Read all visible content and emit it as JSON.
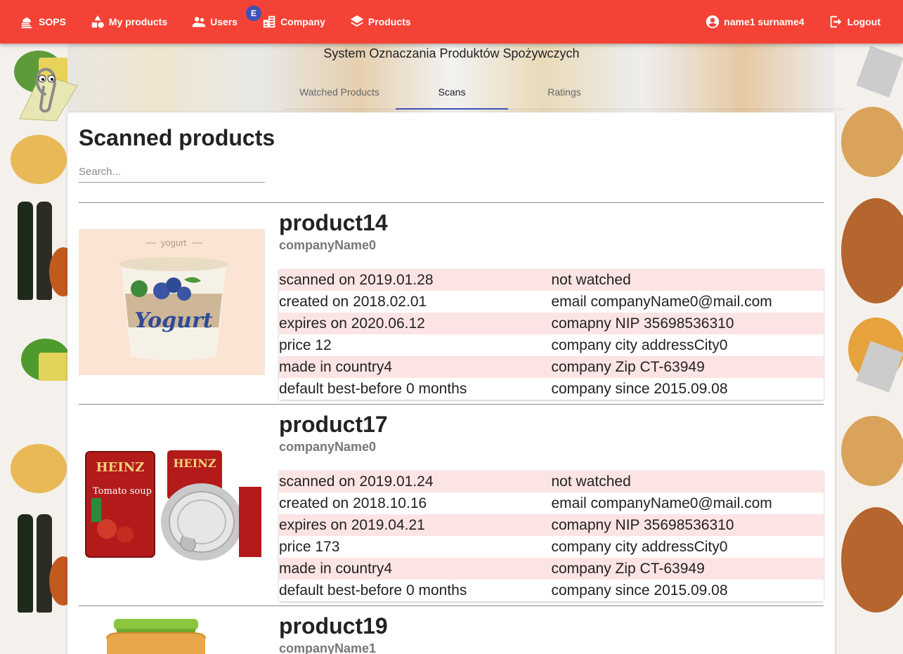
{
  "nav": {
    "brand": "SOPS",
    "my_products": "My products",
    "users": "Users",
    "company": "Company",
    "company_badge": "E",
    "products": "Products",
    "user_name": "name1 surname4",
    "logout": "Logout"
  },
  "app_title": "System Oznaczania Produktów Spożywczych",
  "tabs": [
    "Watched Products",
    "Scans",
    "Ratings"
  ],
  "active_tab": "Scans",
  "page": {
    "heading": "Scanned products",
    "search_placeholder": "Search..."
  },
  "products": [
    {
      "name": "product14",
      "company": "companyName0",
      "image": "yogurt-cup",
      "image_label": "yogurt",
      "image_brand": "Yogurt",
      "left": [
        "scanned on 2019.01.28",
        "created on 2018.02.01",
        "expires on 2020.06.12",
        "price 12",
        "made in country4",
        "default best-before 0 months"
      ],
      "right": [
        "not watched",
        "email companyName0@mail.com",
        "comapny NIP 35698536310",
        "company city addressCity0",
        "company Zip CT-63949",
        "company since 2015.09.08"
      ]
    },
    {
      "name": "product17",
      "company": "companyName0",
      "image": "soup-cans",
      "image_brand": "HEINZ",
      "image_product": "Tomato soup",
      "left": [
        "scanned on 2019.01.24",
        "created on 2018.10.16",
        "expires on 2019.04.21",
        "price 173",
        "made in country4",
        "default best-before 0 months"
      ],
      "right": [
        "not watched",
        "email companyName0@mail.com",
        "comapny NIP 35698536310",
        "company city addressCity0",
        "company Zip CT-63949",
        "company since 2015.09.08"
      ]
    },
    {
      "name": "product19",
      "company": "companyName1",
      "image": "baby-food-jar"
    }
  ],
  "colors": {
    "topbar": "#f44336",
    "accent": "#3f51b5",
    "row_highlight": "#fde4e4"
  }
}
